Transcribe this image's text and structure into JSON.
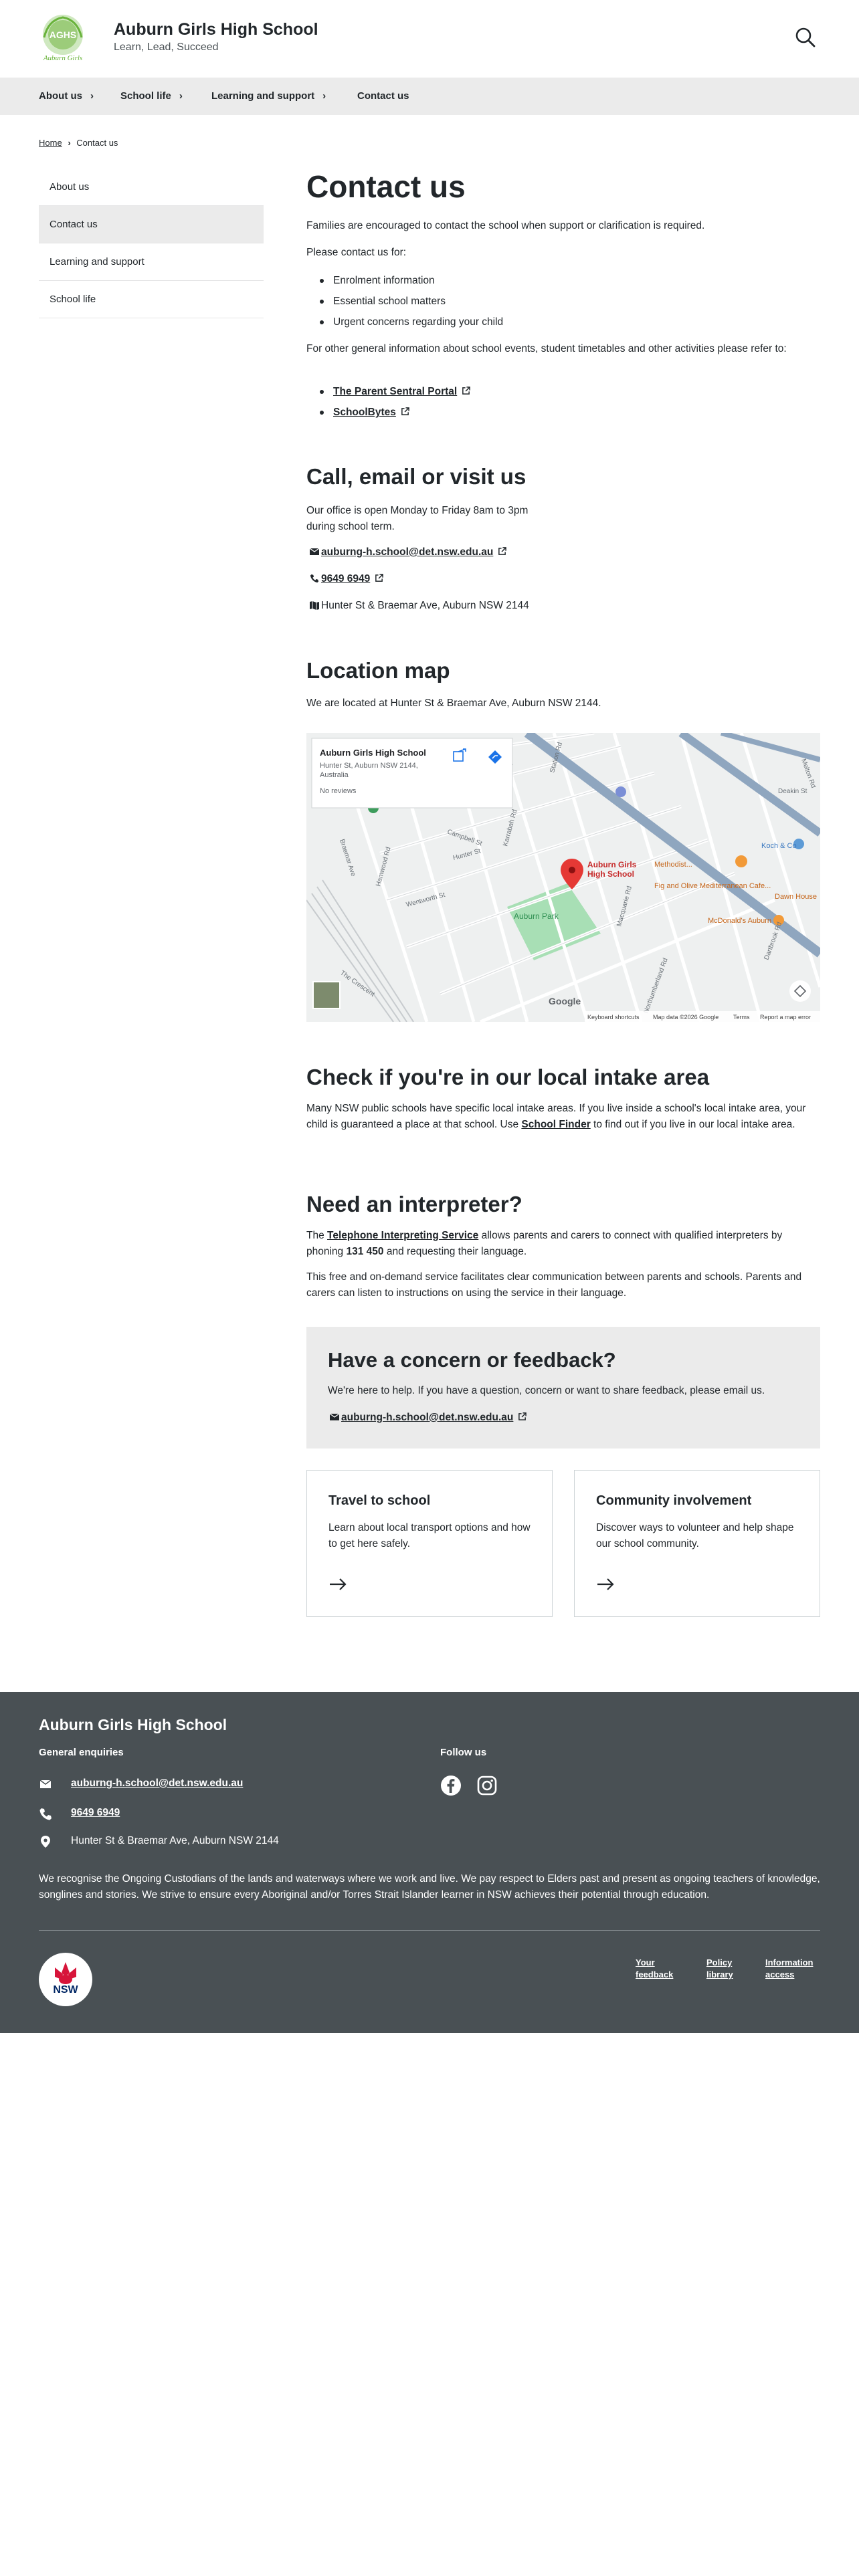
{
  "header": {
    "logo_text": "Auburn Girls",
    "school_name": "Auburn Girls High School",
    "tagline": "Learn, Lead, Succeed"
  },
  "nav": [
    {
      "label": "About us"
    },
    {
      "label": "School life"
    },
    {
      "label": "Learning and support"
    },
    {
      "label": "Contact us"
    }
  ],
  "breadcrumb": {
    "home": "Home",
    "current": "Contact us"
  },
  "sidebar": [
    {
      "label": "About us"
    },
    {
      "label": "Contact us"
    },
    {
      "label": "Learning and support"
    },
    {
      "label": "School life"
    }
  ],
  "main": {
    "title": "Contact us",
    "intro": "Families are encouraged to contact the school when support or clarification is required.",
    "please_contact": "Please contact us for:",
    "reasons": [
      "Enrolment information",
      "Essential school matters",
      "Urgent concerns regarding your child"
    ],
    "other_info": "For other general information about school events, student timetables and other activities please refer to:",
    "links": [
      "The Parent Sentral Portal",
      "SchoolBytes"
    ]
  },
  "call": {
    "heading": "Call, email or visit us",
    "hours_line1": "Our office is open Monday to Friday 8am to 3pm",
    "hours_line2": "during school term.",
    "email": "auburng-h.school@det.nsw.edu.au",
    "phone": "9649 6949",
    "address": "Hunter St & Braemar Ave, Auburn NSW 2144"
  },
  "location": {
    "heading": "Location map",
    "text": "We are located at Hunter St & Braemar Ave, Auburn NSW 2144.",
    "map": {
      "card_title": "Auburn Girls High School",
      "card_address1": "Hunter St, Auburn NSW 2144,",
      "card_address2": "Australia",
      "card_reviews": "No reviews",
      "pin_label1": "Auburn Girls",
      "pin_label2": "High School",
      "places": [
        "Auburn Park",
        "Fig and Olive Mediterranean Cafe...",
        "Methodist...",
        "Koch & Co",
        "Dawn House",
        "McDonald's Auburn"
      ],
      "streets": [
        "Station Rd",
        "Mary St",
        "Braemar Ave",
        "Campbell St",
        "Hunter St",
        "Macquarie Rd",
        "Karrabah Rd",
        "Wentworth St",
        "Helena St",
        "Hamwood Rd",
        "Vernon St",
        "The Crescent",
        "Northumberland Rd",
        "Park Rd",
        "Queen St",
        "Dartbrook Rd",
        "Dunmore St",
        "Byrne St",
        "Melton Rd",
        "Deakin St"
      ],
      "footer_items": [
        "Keyboard shortcuts",
        "Map data ©2026 Google",
        "Terms",
        "Report a map error"
      ],
      "brand": "Google"
    }
  },
  "intake": {
    "heading": "Check if you're in our local intake area",
    "text_before": "Many NSW public schools have specific local intake areas. If you live inside a school's local intake area, your child is guaranteed a place at that school. Use ",
    "link": "School Finder",
    "text_after": " to find out if you live in our local intake area."
  },
  "interpreter": {
    "heading": "Need an interpreter?",
    "p1_before": "The ",
    "p1_link": "Telephone Interpreting Service",
    "p1_mid": " allows parents and carers to connect with qualified interpreters by phoning ",
    "p1_phone": "131 450",
    "p1_after": " and requesting their language.",
    "p2": "This free and on-demand service facilitates clear communication between parents and schools. Parents and carers can listen to instructions on using the service in their language."
  },
  "concern": {
    "heading": "Have a concern or feedback?",
    "text": "We're here to help. If you have a question, concern or want to share feedback, please email us.",
    "email": "auburng-h.school@det.nsw.edu.au"
  },
  "cards": [
    {
      "title": "Travel to school",
      "text": "Learn about local transport options and how to get here safely."
    },
    {
      "title": "Community involvement",
      "text": "Discover ways to volunteer and help shape our school community."
    }
  ],
  "footer": {
    "school_name": "Auburn Girls High School",
    "enquiries_heading": "General enquiries",
    "email": "auburng-h.school@det.nsw.edu.au",
    "phone": "9649 6949",
    "address": "Hunter St & Braemar Ave, Auburn NSW 2144",
    "follow_heading": "Follow us",
    "acknowledgement": "We recognise the Ongoing Custodians of the lands and waterways where we work and live. We pay respect to Elders past and present as ongoing teachers of knowledge, songlines and stories. We strive to ensure every Aboriginal and/or Torres Strait Islander learner in NSW achieves their potential through education.",
    "nsw_logo_text": "NSW",
    "links": [
      {
        "line1": "Your",
        "line2": "feedback"
      },
      {
        "line1": "Policy",
        "line2": "library"
      },
      {
        "line1": "Information",
        "line2": "access"
      }
    ]
  },
  "colors": {
    "text": "#22272b",
    "nav_bg": "#ebebeb",
    "footer_bg": "#495054",
    "map_pin": "#e53935",
    "park_green": "#a8dfb5",
    "logo_green": "#69b33b",
    "nsw_red": "#d7153a",
    "nsw_blue": "#002664"
  },
  "icons": [
    "search-icon",
    "chevron-right-icon",
    "external-link-icon",
    "email-icon",
    "phone-icon",
    "map-icon",
    "location-pin-icon",
    "arrow-right-icon",
    "facebook-icon",
    "instagram-icon",
    "directions-icon",
    "open-in-new-icon",
    "fullscreen-icon"
  ]
}
